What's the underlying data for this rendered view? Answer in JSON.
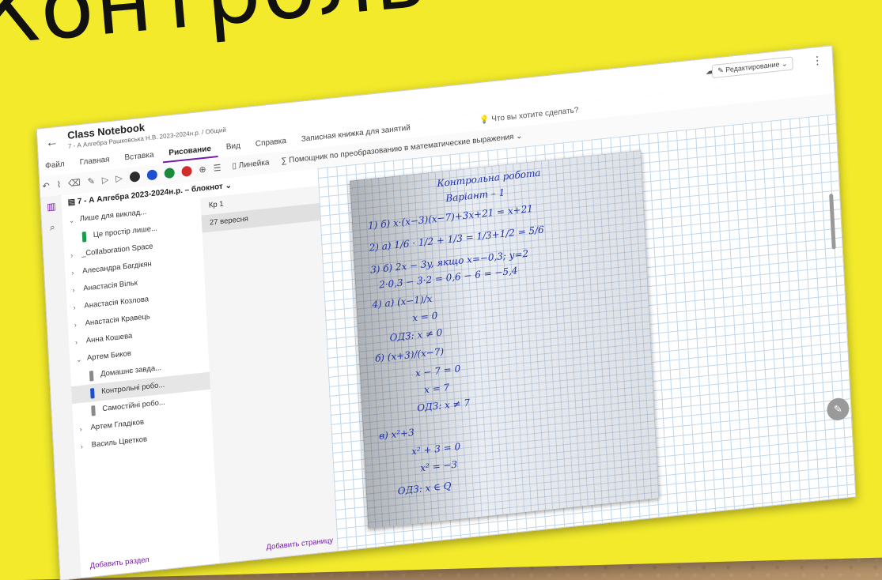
{
  "headline": "Контроль",
  "app": {
    "title": "Class Notebook",
    "breadcrumb": "7 - А Алгебра Рашковська Н.В. 2023-2024н.р. / Общий",
    "edit_mode": "Редактирование",
    "more": "⋮"
  },
  "ribbon": {
    "tabs": [
      "Файл",
      "Главная",
      "Вставка",
      "Рисование",
      "Вид",
      "Справка",
      "Записная книжка для занятий"
    ],
    "active_tab": "Рисование",
    "tell_me": "Что вы хотите сделать?",
    "ruler_label": "Линейка",
    "math_label": "Помощник по преобразованию в математические выражения",
    "pen_colors": [
      "#2b2b2b",
      "#1f4fd1",
      "#1a8a3a",
      "#d12b2b"
    ]
  },
  "notebook": {
    "title": "7 - А Алгебра 2023-2024н.р. – блокнот",
    "sections": [
      {
        "label": "Лише для виклад...",
        "level": 0,
        "chev": "⌄"
      },
      {
        "label": "Це простір лише...",
        "level": 1,
        "color": "#1a9a4a"
      },
      {
        "label": "_Collaboration Space",
        "level": 0,
        "chev": "›"
      },
      {
        "label": "Алесандра Багдікян",
        "level": 0,
        "chev": "›"
      },
      {
        "label": "Анастасія Вільк",
        "level": 0,
        "chev": "›"
      },
      {
        "label": "Анастасія Козлова",
        "level": 0,
        "chev": "›"
      },
      {
        "label": "Анастасія Кравець",
        "level": 0,
        "chev": "›"
      },
      {
        "label": "Анна Кошева",
        "level": 0,
        "chev": "›"
      },
      {
        "label": "Артем Биков",
        "level": 0,
        "chev": "⌄"
      },
      {
        "label": "Домашнє завда...",
        "level": 1,
        "color": "#8a8a8a"
      },
      {
        "label": "Контрольні робо...",
        "level": 1,
        "color": "#1f4fd1",
        "selected": true
      },
      {
        "label": "Самостійні робо...",
        "level": 1,
        "color": "#8a8a8a"
      },
      {
        "label": "Артем Гладіков",
        "level": 0,
        "chev": "›"
      },
      {
        "label": "Василь Цветков",
        "level": 0,
        "chev": "›"
      }
    ],
    "add_section": "Добавить раздел",
    "pages": [
      {
        "label": "Кр 1"
      },
      {
        "label": "27 вересня",
        "selected": true
      }
    ],
    "add_page": "Добавить страницу"
  },
  "handwriting": [
    "Контрольна робота",
    "Варіант – 1",
    "1) б) x·(x−3)(x−7)+3x+21 = x+21",
    "2) a) 1/6 · 1/2 + 1/3 = 1/3+1/2 = 5/6",
    "3) б) 2x − 3y, якщо x=−0,3; y=2",
    "2·0,3 − 3·2 = 0,6 − 6 = −5,4",
    "4) a) (x−1)/x",
    "x = 0",
    "ОДЗ: x ≠ 0",
    "б) (x+3)/(x−7)",
    "x − 7 = 0",
    "x = 7",
    "ОДЗ: x ≠ 7",
    "в) x²+3",
    "x² + 3 = 0",
    "x² = −3",
    "ОДЗ: x ∈ Q"
  ]
}
